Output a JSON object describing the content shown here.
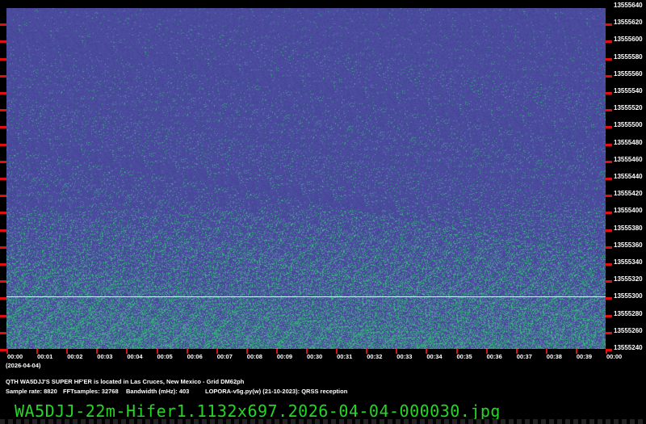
{
  "colors": {
    "background": "#4b4b9e",
    "noise": "#3fa08a",
    "carrier": "#e8f0ff",
    "tick": "#e01010",
    "filename": "#22d822"
  },
  "frequency_labels": [
    "13555640",
    "13555620",
    "13555600",
    "13555580",
    "13555560",
    "13555540",
    "13555520",
    "13555500",
    "13555480",
    "13555460",
    "13555440",
    "13555420",
    "13555400",
    "13555380",
    "13555360",
    "13555340",
    "13555320",
    "13555300",
    "13555280",
    "13555260",
    "13555240"
  ],
  "carrier_frequency": 13555297,
  "time_labels": [
    "00:00",
    "00:01",
    "00:02",
    "00:03",
    "00:04",
    "00:05",
    "00:06",
    "00:07",
    "00:08",
    "00:09",
    "00:30",
    "00:31",
    "00:32",
    "00:33",
    "00:34",
    "00:35",
    "00:36",
    "00:37",
    "00:38",
    "00:39",
    "00:00"
  ],
  "date": "(2026-04-04)",
  "info": {
    "qth": "QTH WA5DJJ'S SUPER HF'ER is located in Las Cruces, New Mexico - Grid DM62ph",
    "sample_rate": "Sample rate: 8820",
    "fft": "FFTsamples: 32768",
    "bandwidth": "Bandwidth (mHz): 403",
    "software": "LOPORA-v5g.py(w) (21-10-2023): QRSS reception"
  },
  "filename": "WA5DJJ-22m-Hifer1.1132x697.2026-04-04-000030.jpg"
}
